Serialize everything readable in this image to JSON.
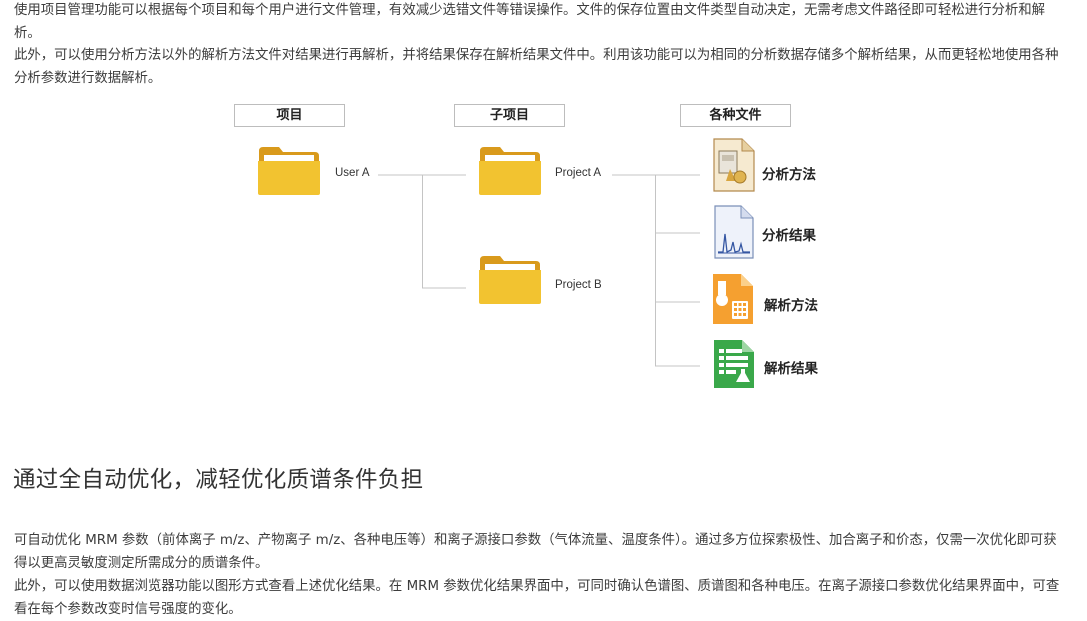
{
  "intro": {
    "paragraph1": "使用项目管理功能可以根据每个项目和每个用户进行文件管理，有效减少选错文件等错误操作。文件的保存位置由文件类型自动决定，无需考虑文件路径即可轻松进行分析和解析。",
    "paragraph2": "此外，可以使用分析方法以外的解析方法文件对结果进行再解析，并将结果保存在解析结果文件中。利用该功能可以为相同的分析数据存储多个解析结果，从而更轻松地使用各种分析参数进行数据解析。"
  },
  "diagram": {
    "headers": {
      "project": "项目",
      "subproject": "子项目",
      "files": "各种文件"
    },
    "user": "User A",
    "projects": [
      "Project A",
      "Project B"
    ],
    "files": [
      "分析方法",
      "分析结果",
      "解析方法",
      "解析结果"
    ],
    "colors": {
      "folder": "#f2c330",
      "folder_back": "#d99a1c",
      "line": "#c4c4c4"
    },
    "icons": [
      "folder-icon",
      "analysis-method-file-icon",
      "analysis-result-file-icon",
      "parse-method-file-icon",
      "parse-result-file-icon"
    ]
  },
  "section": {
    "heading": "通过全自动优化，减轻优化质谱条件负担",
    "paragraph1": "可自动优化 MRM 参数（前体离子 m/z、产物离子 m/z、各种电压等）和离子源接口参数（气体流量、温度条件）。通过多方位探索极性、加合离子和价态，仅需一次优化即可获得以更高灵敏度测定所需成分的质谱条件。",
    "paragraph2": "此外，可以使用数据浏览器功能以图形方式查看上述优化结果。在 MRM 参数优化结果界面中，可同时确认色谱图、质谱图和各种电压。在离子源接口参数优化结果界面中，可查看在每个参数改变时信号强度的变化。"
  }
}
